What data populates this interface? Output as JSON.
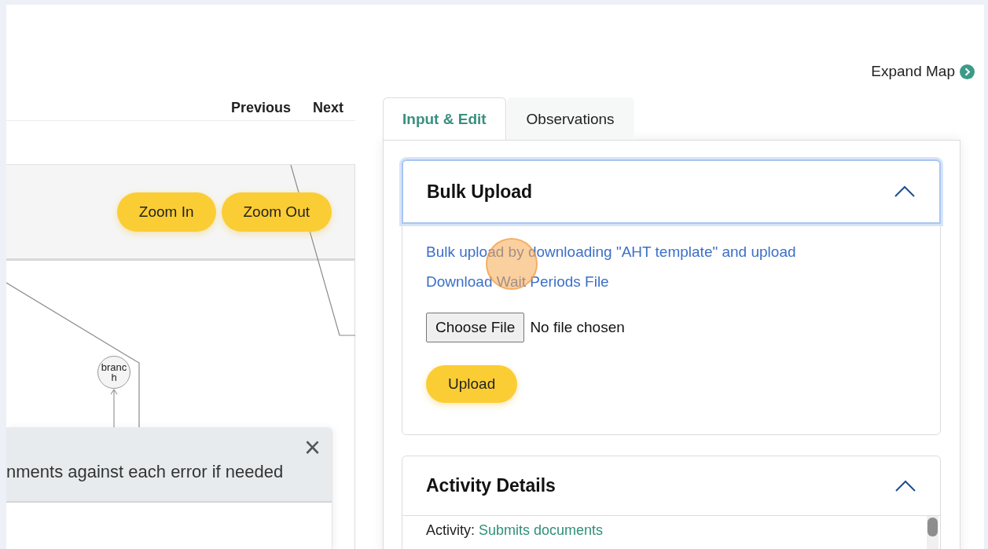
{
  "nav": {
    "links": [
      "Previous",
      "Next"
    ]
  },
  "map": {
    "buttons": [
      "Zoom In",
      "Zoom Out"
    ],
    "nodes": [
      {
        "label": "branch"
      }
    ],
    "notice": {
      "text": "nments against each error if needed",
      "close": "×"
    }
  },
  "expand_map": {
    "label": "Expand Map"
  },
  "tabs": [
    {
      "label": "Input & Edit",
      "selected": true
    },
    {
      "label": "Observations",
      "selected": false
    }
  ],
  "bulk_upload": {
    "title": "Bulk Upload",
    "expanded": true,
    "links": [
      "Bulk upload by downloading \"AHT template\" and upload",
      "Download Wait Periods File"
    ],
    "file_input": {
      "button": "Choose File",
      "status": "No file chosen"
    },
    "upload_button": "Upload"
  },
  "activity_details": {
    "title": "Activity Details",
    "expanded": true,
    "fields": [
      {
        "label": "Activity:",
        "value": "Submits documents"
      }
    ]
  }
}
